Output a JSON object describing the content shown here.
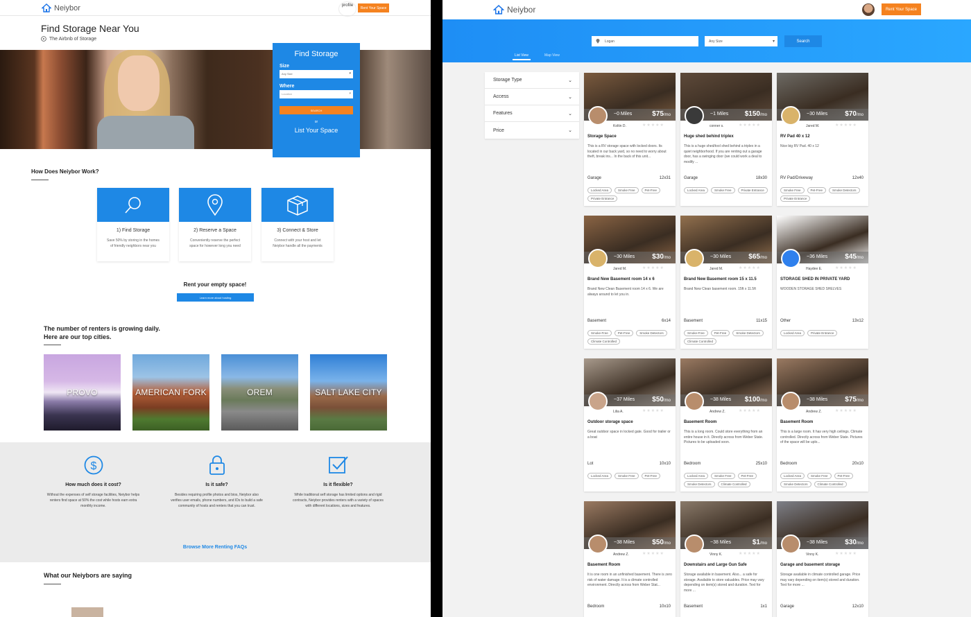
{
  "left": {
    "brand": "Neiybor",
    "profile": "profile",
    "rent_button": "Rent Your Space",
    "title": "Find Storage Near You",
    "subtitle": "The Airbnb of Storage",
    "find_box": {
      "heading": "Find Storage",
      "size_label": "Size",
      "size_value": "Any Size",
      "where_label": "Where",
      "where_placeholder": "Location",
      "search": "SEARCH",
      "or": "or",
      "list": "List Your Space"
    },
    "how_heading": "How Does Neiybor Work?",
    "steps": [
      {
        "title": "1) Find Storage",
        "desc": "Save 50% by storing in the homes of friendly neighbors near you"
      },
      {
        "title": "2) Reserve a Space",
        "desc": "Conveniently reserve the perfect space for however long you need"
      },
      {
        "title": "3) Connect & Store",
        "desc": "Connect with your host and let Neiybor handle all the payments"
      }
    ],
    "rent_empty": "Rent your empty space!",
    "learn_more": "Learn more about hosting",
    "renters_line1": "The number of renters is growing daily.",
    "renters_line2": "Here are our top cities.",
    "cities": [
      "PROVO",
      "AMERICAN FORK",
      "OREM",
      "SALT LAKE CITY"
    ],
    "faqs": [
      {
        "q": "How much does it cost?",
        "a": "Without the expenses of self storage facilities, Neiybor helps renters find space at 50% the cost while hosts earn extra monthly income."
      },
      {
        "q": "Is it safe?",
        "a": "Besides requiring profile photos and bios, Neiybor also verifies user emails, phone numbers, and IDs to build a safe community of hosts and renters that you can trust."
      },
      {
        "q": "Is it flexible?",
        "a": "While traditional self storage has limited options and rigid contracts, Neiybor provides renters with a variety of spaces with different locations, sizes and features."
      }
    ],
    "browse_faqs": "Browse More Renting FAQs",
    "testimonials_heading": "What our Neiybors are saying"
  },
  "right": {
    "brand": "Neiybor",
    "rent_button": "Rent Your Space",
    "location_value": "Logan",
    "size_value": "Any Size",
    "search": "Search",
    "tabs": [
      "List View",
      "Map View"
    ],
    "filters": [
      "Storage Type",
      "Access",
      "Features",
      "Price"
    ],
    "listings": [
      {
        "miles": "~0 Miles",
        "price": "$75",
        "unit": "/mo",
        "host": "Koltin D.",
        "title": "Storage Space",
        "desc": "This is a RV storage space with locked doors. Its located in our back yard, so no need to worry about theft, break ins... In the back of this unit...",
        "type": "Garage",
        "size": "12x31",
        "tags": [
          "Locked Area",
          "Smoke Free",
          "Pet-Free",
          "Private Entrance"
        ],
        "bg": "#7a5a3e",
        "av": "#b88d6c"
      },
      {
        "miles": "~1 Miles",
        "price": "$150",
        "unit": "/mo",
        "host": "conner s.",
        "title": "Huge shed behind triplex",
        "desc": "This is a huge shed/tool shed behind a triplex in a quiet neighborhood. If you are renting out a garage door, has a swinging door (we could work a deal to modify ...",
        "type": "Garage",
        "size": "18x30",
        "tags": [
          "Locked Area",
          "Smoke Free",
          "Private Entrance"
        ],
        "bg": "#5e4a3a",
        "av": "#3a3a3a"
      },
      {
        "miles": "~30 Miles",
        "price": "$70",
        "unit": "/mo",
        "host": "Jared M.",
        "title": "RV Pad 40 x 12",
        "desc": "Nice big RV Pad. 40 x 12",
        "type": "RV Pad/Driveway",
        "size": "12x40",
        "tags": [
          "Smoke Free",
          "Pet-Free",
          "Smoke Detectors",
          "Private Entrance"
        ],
        "bg": "#6d6a64",
        "av": "#d9b36a"
      },
      {
        "miles": "~30 Miles",
        "price": "$30",
        "unit": "/mo",
        "host": "Jared M.",
        "title": "Brand New Basement room 14 x 6",
        "desc": "Brand New Clean Basement room 14 x 6. We are always around to let you in.",
        "type": "Basement",
        "size": "6x14",
        "tags": [
          "Smoke-Free",
          "Pet-Free",
          "Smoke Detectors",
          "Climate Controlled"
        ],
        "bg": "#8a6444",
        "av": "#d9b36a"
      },
      {
        "miles": "~30 Miles",
        "price": "$65",
        "unit": "/mo",
        "host": "Jared M.",
        "title": "Brand New Basement room 15 x 11.5",
        "desc": "Brand New Clean basement room. 15ft x 11.5ft",
        "type": "Basement",
        "size": "11x15",
        "tags": [
          "Smoke-Free",
          "Pet-Free",
          "Smoke Detectors",
          "Climate Controlled"
        ],
        "bg": "#92704e",
        "av": "#d9b36a"
      },
      {
        "miles": "~36 Miles",
        "price": "$45",
        "unit": "/mo",
        "host": "Haydee E.",
        "title": "STORAGE SHED IN PRIVATE YARD",
        "desc": "WOODEN STORAGE SHED SHELVES",
        "type": "Other",
        "size": "13x12",
        "tags": [
          "Locked Area",
          "Private Entrance"
        ],
        "bg": "#ffffff",
        "av": "#2f80ed"
      },
      {
        "miles": "~37 Miles",
        "price": "$50",
        "unit": "/mo",
        "host": "Lilia A.",
        "title": "Outdoor storage space",
        "desc": "Great outdoor space in locked gate. Good for trailer or a boat",
        "type": "Lot",
        "size": "10x10",
        "tags": [
          "Locked Area",
          "Smoke Free",
          "Pet-Free"
        ],
        "bg": "#a89a8c",
        "av": "#c9a48a"
      },
      {
        "miles": "~38 Miles",
        "price": "$100",
        "unit": "/mo",
        "host": "Andrew Z.",
        "title": "Basement Room",
        "desc": "This is a long room. Could store everything from an entire house in it. Directly across from Weber State. Pictures to be uploaded soon.",
        "type": "Bedroom",
        "size": "25x10",
        "tags": [
          "Locked Area",
          "Smoke Free",
          "Pet-Free",
          "Smoke Detectors",
          "Climate Controlled"
        ],
        "bg": "#9a7a62",
        "av": "#b88d6c"
      },
      {
        "miles": "~38 Miles",
        "price": "$75",
        "unit": "/mo",
        "host": "Andrew Z.",
        "title": "Basement Room",
        "desc": "This is a large room. It has very high ceilings. Climate controlled. Directly across from Weber State. Pictures of the space will be uplo...",
        "type": "Bedroom",
        "size": "20x10",
        "tags": [
          "Locked Area",
          "Smoke Free",
          "Pet-Free",
          "Smoke Detectors",
          "Climate Controlled"
        ],
        "bg": "#9a7a62",
        "av": "#b88d6c"
      },
      {
        "miles": "~38 Miles",
        "price": "$50",
        "unit": "/mo",
        "host": "Andrew Z.",
        "title": "Basement Room",
        "desc": "It is one room in an unfinished basement. There is zero risk of water damage. It is a climate controlled environment. Directly across from Weber Stat...",
        "type": "Bedroom",
        "size": "10x10",
        "tags": [],
        "bg": "#9a7a62",
        "av": "#b88d6c"
      },
      {
        "miles": "~38 Miles",
        "price": "$1",
        "unit": "/mo",
        "host": "Vinny K.",
        "title": "Downstairs and Large Gun Safe",
        "desc": "Storage available in basement. Also... a safe for storage. Available to store valuables. Price may vary depending on item(s) stored and duration. Text for more ...",
        "type": "Basement",
        "size": "1x1",
        "tags": [],
        "bg": "#8a7a6a",
        "av": "#b88d6c"
      },
      {
        "miles": "~38 Miles",
        "price": "$30",
        "unit": "/mo",
        "host": "Vinny K.",
        "title": "Garage and basement storage",
        "desc": "Storage available in climate controlled garage. Price may vary depending on item(s) stored and duration. Text for more ...",
        "type": "Garage",
        "size": "12x10",
        "tags": [],
        "bg": "#7e8088",
        "av": "#b88d6c"
      }
    ]
  },
  "colors": {
    "primary": "#1e88e5",
    "accent": "#f5821f"
  }
}
